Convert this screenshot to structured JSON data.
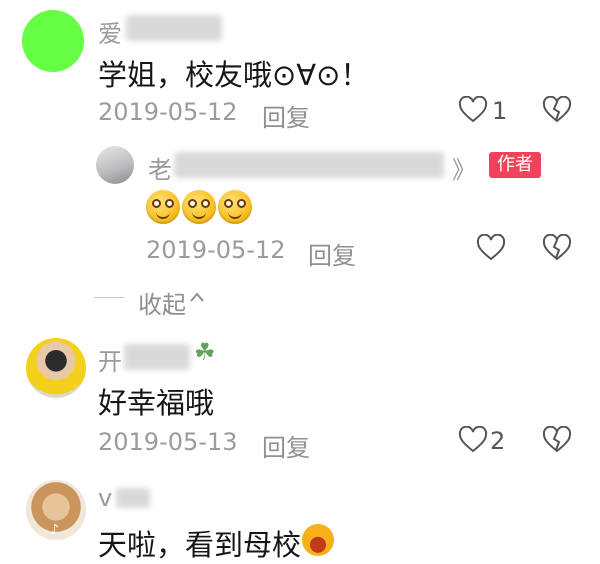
{
  "comments": [
    {
      "name_visible": "爱",
      "text": "学姐，校友哦⊙∀⊙！",
      "date": "2019-05-12",
      "reply_label": "回复",
      "like_count": "1"
    },
    {
      "name_visible_start": "老",
      "name_visible_end": "》",
      "badge": "作者",
      "emoji_count": 3,
      "date": "2019-05-12",
      "reply_label": "回复"
    },
    {
      "name_visible": "开",
      "text": "好幸福哦",
      "date": "2019-05-13",
      "reply_label": "回复",
      "like_count": "2"
    },
    {
      "name_visible": "v",
      "text": "天啦，看到母校"
    }
  ],
  "collapse_label": "收起",
  "colors": {
    "badge_bg": "#f0425a",
    "avatar_green": "#66ff44"
  }
}
